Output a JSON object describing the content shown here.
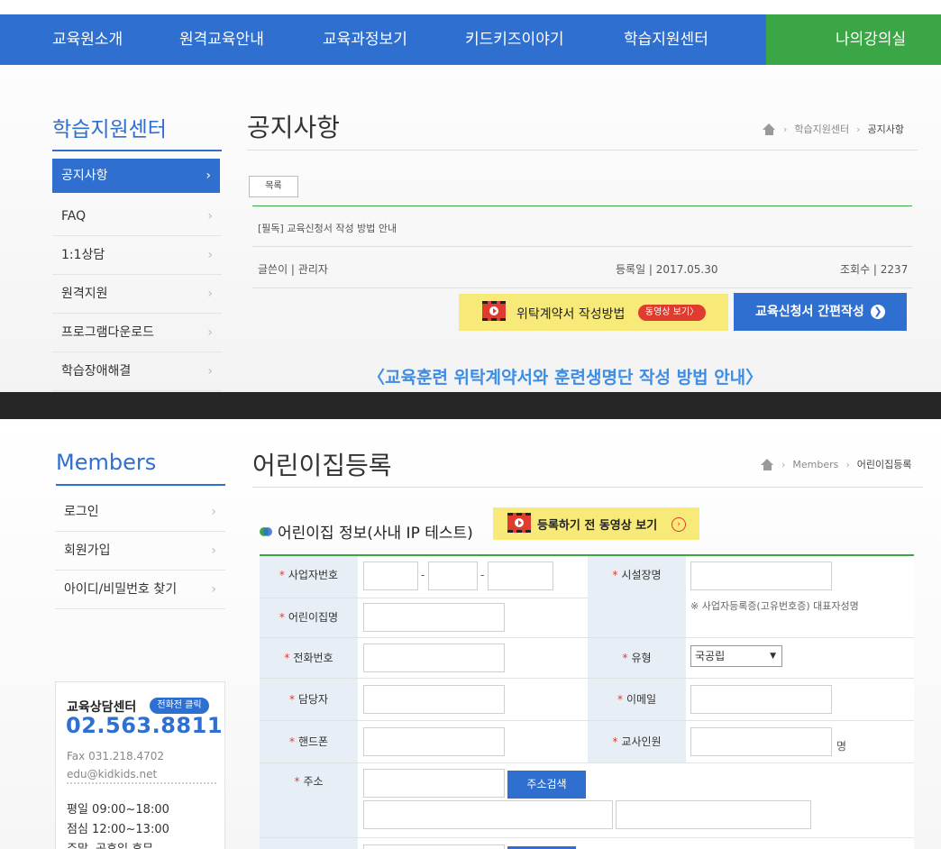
{
  "nav": {
    "items": [
      "교육원소개",
      "원격교육안내",
      "교육과정보기",
      "키드키즈이야기",
      "학습지원센터"
    ],
    "my_lecture": "나의강의실"
  },
  "top_panel": {
    "sidebar": {
      "title": "학습지원센터",
      "items": [
        "공지사항",
        "FAQ",
        "1:1상담",
        "원격지원",
        "프로그램다운로드",
        "학습장애해결"
      ],
      "active_index": 0
    },
    "page_title": "공지사항",
    "breadcrumb": [
      "학습지원센터",
      "공지사항"
    ],
    "list_button": "목록",
    "post": {
      "title": "[필독] 교육신청서 작성 방법 안내",
      "author": "글쓴이 | 관리자",
      "date": "등록일 | 2017.05.30",
      "views": "조회수 | 2237"
    },
    "contract_button": "위탁계약서 작성방법",
    "video_badge": "동영상 보기〉",
    "apply_button": "교육신청서 간편작성",
    "heading": "〈교육훈련 위탁계약서와 훈련생명단 작성 방법 안내〉"
  },
  "bottom_panel": {
    "sidebar": {
      "title": "Members",
      "items": [
        "로그인",
        "회원가입",
        "아이디/비밀번호 찾기"
      ]
    },
    "page_title": "어린이집등록",
    "breadcrumb": [
      "Members",
      "어린이집등록"
    ],
    "section_title": "어린이집 정보(사내 IP 테스트)",
    "video_button": "등록하기 전 동영상 보기",
    "consult": {
      "title": "교육상담센터",
      "badge": "전화전 클릭",
      "phone": "02.563.8811",
      "fax": "Fax 031.218.4702",
      "email": "edu@kidkids.net",
      "hours": [
        "평일 09:00~18:00",
        "점심 12:00~13:00",
        "주말, 공휴일 휴무"
      ]
    },
    "form": {
      "business_no": "사업자번호",
      "facility_head": "시설장명",
      "facility_note": "※ 사업자등록증(고유번호증) 대표자성명",
      "daycare_name": "어린이집명",
      "phone": "전화번호",
      "type": "유형",
      "type_value": "국공립",
      "manager": "담당자",
      "email": "이메일",
      "mobile": "핸드폰",
      "teachers": "교사인원",
      "teachers_unit": "명",
      "address": "주소",
      "address_search": "주소검색",
      "required_mark": "*",
      "dash": "-"
    }
  },
  "colors": {
    "primary": "#2e6fd0",
    "green": "#3aa645",
    "yellow": "#f7ea78",
    "red": "#e03b2f"
  }
}
